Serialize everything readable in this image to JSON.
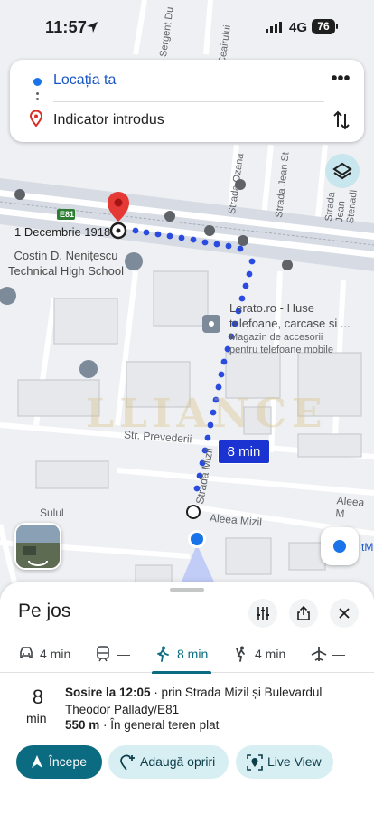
{
  "status_bar": {
    "time": "11:57",
    "network": "4G",
    "battery": "76"
  },
  "route": {
    "origin": "Locația ta",
    "destination": "Indicator introdus",
    "origin_color": "#1a73e8",
    "destination_color": "#d93025"
  },
  "map": {
    "streets": [
      "Sergent Du",
      "Ceairului",
      "Strada Ozana",
      "Strada Jean St",
      "Strada Jean Steriadi",
      "Str. Prevederii",
      "Strada Mizil",
      "Aleea Mizil",
      "Aleea M",
      "Sulul",
      "E81"
    ],
    "destination_label": "1 Decembrie 1918",
    "school_label": "Costin D. Nenițescu Technical High School",
    "poi_name": "Lerato.ro - Huse telefoane, carcase si ...",
    "poi_subtitle": "Magazin de accesorii pentru telefoane mobile",
    "edge_label": "tM",
    "watermark": "LLIANCE",
    "route_time_badge": "8 min",
    "route_color": "#1a33d1"
  },
  "sheet": {
    "title": "Pe jos",
    "modes": [
      {
        "icon": "car-icon",
        "label": "4 min",
        "active": false
      },
      {
        "icon": "transit-icon",
        "label": "—",
        "active": false
      },
      {
        "icon": "walking-icon",
        "label": "8 min",
        "active": true
      },
      {
        "icon": "ride-icon",
        "label": "4 min",
        "active": false
      },
      {
        "icon": "flight-icon",
        "label": "—",
        "active": false
      }
    ],
    "duration_value": "8",
    "duration_unit": "min",
    "arrival_bold": "Sosire la 12:05",
    "arrival_rest": " · prin Strada Mizil și Bulevardul Theodor Pallady/E81",
    "distance_bold": "550 m",
    "distance_rest": " · În general teren plat",
    "actions": {
      "start": "Începe",
      "add_stops": "Adaugă opriri",
      "live_view": "Live View"
    },
    "accent_color": "#0b6b80"
  }
}
